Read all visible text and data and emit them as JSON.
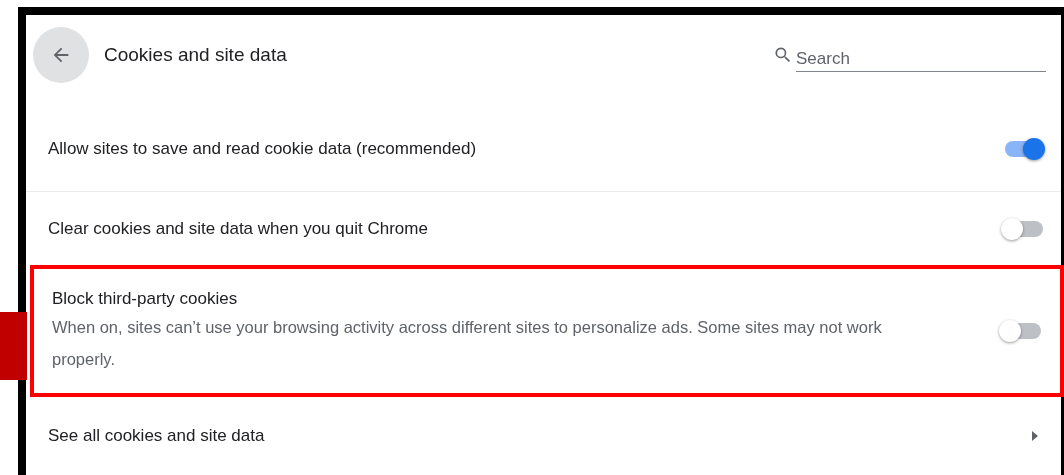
{
  "header": {
    "title": "Cookies and site data"
  },
  "search": {
    "placeholder": "Search"
  },
  "settings": [
    {
      "kind": "toggle",
      "label": "Allow sites to save and read cookie data (recommended)",
      "on": true,
      "highlighted": false
    },
    {
      "kind": "toggle",
      "label": "Clear cookies and site data when you quit Chrome",
      "on": false,
      "highlighted": false
    },
    {
      "kind": "toggle",
      "label": "Block third-party cookies",
      "description": "When on, sites can’t use your browsing activity across different sites to personalize ads. Some sites may not work properly.",
      "on": false,
      "highlighted": true
    },
    {
      "kind": "link",
      "label": "See all cookies and site data",
      "highlighted": false
    }
  ]
}
